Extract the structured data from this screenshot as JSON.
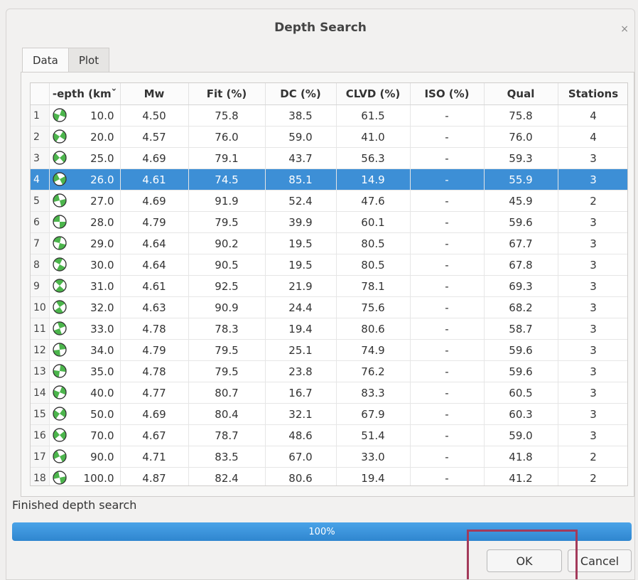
{
  "dialog": {
    "title": "Depth Search",
    "close_glyph": "×"
  },
  "tabs": [
    {
      "label": "Data"
    },
    {
      "label": "Plot"
    }
  ],
  "table": {
    "headers": [
      "‑epth (kmˇ",
      "Mw",
      "Fit (%)",
      "DC (%)",
      "CLVD (%)",
      "ISO (%)",
      "Qual",
      "Stations"
    ],
    "selected_row": 4,
    "rows": [
      {
        "idx": "1",
        "depth": "10.0",
        "mw": "4.50",
        "fit": "75.8",
        "dc": "38.5",
        "clvd": "61.5",
        "iso": "-",
        "qual": "75.8",
        "stations": "4"
      },
      {
        "idx": "2",
        "depth": "20.0",
        "mw": "4.57",
        "fit": "76.0",
        "dc": "59.0",
        "clvd": "41.0",
        "iso": "-",
        "qual": "76.0",
        "stations": "4"
      },
      {
        "idx": "3",
        "depth": "25.0",
        "mw": "4.69",
        "fit": "79.1",
        "dc": "43.7",
        "clvd": "56.3",
        "iso": "-",
        "qual": "59.3",
        "stations": "3"
      },
      {
        "idx": "4",
        "depth": "26.0",
        "mw": "4.61",
        "fit": "74.5",
        "dc": "85.1",
        "clvd": "14.9",
        "iso": "-",
        "qual": "55.9",
        "stations": "3"
      },
      {
        "idx": "5",
        "depth": "27.0",
        "mw": "4.69",
        "fit": "91.9",
        "dc": "52.4",
        "clvd": "47.6",
        "iso": "-",
        "qual": "45.9",
        "stations": "2"
      },
      {
        "idx": "6",
        "depth": "28.0",
        "mw": "4.79",
        "fit": "79.5",
        "dc": "39.9",
        "clvd": "60.1",
        "iso": "-",
        "qual": "59.6",
        "stations": "3"
      },
      {
        "idx": "7",
        "depth": "29.0",
        "mw": "4.64",
        "fit": "90.2",
        "dc": "19.5",
        "clvd": "80.5",
        "iso": "-",
        "qual": "67.7",
        "stations": "3"
      },
      {
        "idx": "8",
        "depth": "30.0",
        "mw": "4.64",
        "fit": "90.5",
        "dc": "19.5",
        "clvd": "80.5",
        "iso": "-",
        "qual": "67.8",
        "stations": "3"
      },
      {
        "idx": "9",
        "depth": "31.0",
        "mw": "4.61",
        "fit": "92.5",
        "dc": "21.9",
        "clvd": "78.1",
        "iso": "-",
        "qual": "69.3",
        "stations": "3"
      },
      {
        "idx": "10",
        "depth": "32.0",
        "mw": "4.63",
        "fit": "90.9",
        "dc": "24.4",
        "clvd": "75.6",
        "iso": "-",
        "qual": "68.2",
        "stations": "3"
      },
      {
        "idx": "11",
        "depth": "33.0",
        "mw": "4.78",
        "fit": "78.3",
        "dc": "19.4",
        "clvd": "80.6",
        "iso": "-",
        "qual": "58.7",
        "stations": "3"
      },
      {
        "idx": "12",
        "depth": "34.0",
        "mw": "4.79",
        "fit": "79.5",
        "dc": "25.1",
        "clvd": "74.9",
        "iso": "-",
        "qual": "59.6",
        "stations": "3"
      },
      {
        "idx": "13",
        "depth": "35.0",
        "mw": "4.78",
        "fit": "79.5",
        "dc": "23.8",
        "clvd": "76.2",
        "iso": "-",
        "qual": "59.6",
        "stations": "3"
      },
      {
        "idx": "14",
        "depth": "40.0",
        "mw": "4.77",
        "fit": "80.7",
        "dc": "16.7",
        "clvd": "83.3",
        "iso": "-",
        "qual": "60.5",
        "stations": "3"
      },
      {
        "idx": "15",
        "depth": "50.0",
        "mw": "4.69",
        "fit": "80.4",
        "dc": "32.1",
        "clvd": "67.9",
        "iso": "-",
        "qual": "60.3",
        "stations": "3"
      },
      {
        "idx": "16",
        "depth": "70.0",
        "mw": "4.67",
        "fit": "78.7",
        "dc": "48.6",
        "clvd": "51.4",
        "iso": "-",
        "qual": "59.0",
        "stations": "3"
      },
      {
        "idx": "17",
        "depth": "90.0",
        "mw": "4.71",
        "fit": "83.5",
        "dc": "67.0",
        "clvd": "33.0",
        "iso": "-",
        "qual": "41.8",
        "stations": "2"
      },
      {
        "idx": "18",
        "depth": "100.0",
        "mw": "4.87",
        "fit": "82.4",
        "dc": "80.6",
        "clvd": "19.4",
        "iso": "-",
        "qual": "41.2",
        "stations": "2"
      }
    ]
  },
  "status": {
    "text": "Finished depth search"
  },
  "progress": {
    "value": 100,
    "label": "100%"
  },
  "buttons": {
    "ok": "OK",
    "cancel": "Cancel"
  },
  "colors": {
    "selection": "#3d8fd6",
    "beachball": "#4cb54c",
    "highlight": "#a33a5a"
  }
}
